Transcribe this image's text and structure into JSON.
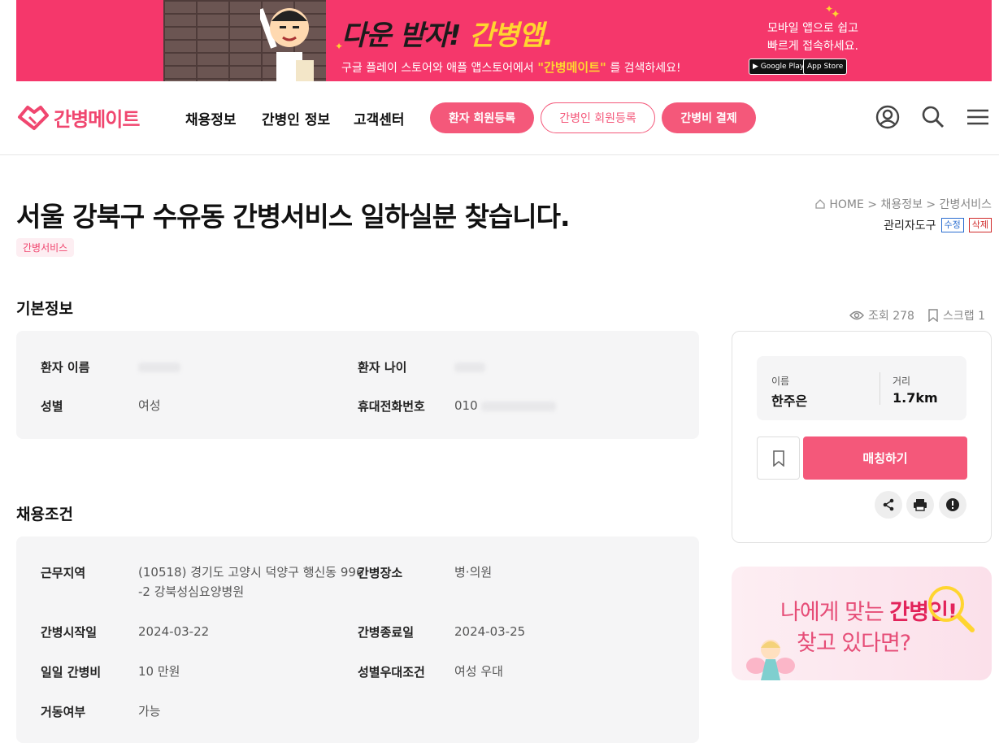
{
  "banner": {
    "title_a": "다운 받자!",
    "title_b": "간병앱.",
    "sub_a": "구글 플레이 스토어와 애플 앱스토어에서",
    "sub_q": "\"간병메이트\"",
    "sub_b": "를 검색하세요!",
    "right_l1": "모바일 앱으로 쉽고",
    "right_l2": "빠르게 접속하세요.",
    "google_play": "Google Play",
    "app_store": "App Store"
  },
  "nav": {
    "logo": "간병메이트",
    "menu": [
      "채용정보",
      "간병인 정보",
      "고객센터"
    ],
    "btn_patient": "환자 회원등록",
    "btn_caregiver": "간병인 회원등록",
    "btn_pay": "간병비 결제"
  },
  "post": {
    "title": "서울 강북구 수유동 간병서비스 일하실분 찾습니다.",
    "tag": "간병서비스",
    "breadcrumb": "HOME > 채용정보 > 간병서비스",
    "admin_label": "관리자도구",
    "edit": "수정",
    "delete": "삭제"
  },
  "basic": {
    "heading": "기본정보",
    "name_label": "환자 이름",
    "age_label": "환자 나이",
    "gender_label": "성별",
    "gender_value": "여성",
    "phone_label": "휴대전화번호",
    "phone_value": "010"
  },
  "conditions": {
    "heading": "채용조건",
    "area_label": "근무지역",
    "area_value_1": "(10518) 경기도 고양시 덕양구 행신동 996",
    "area_value_2": "-2 강북성심요양병원",
    "place_label": "간병장소",
    "place_value": "병·의원",
    "start_label": "간병시작일",
    "start_value": "2024-03-22",
    "end_label": "간병종료일",
    "end_value": "2024-03-25",
    "fee_label": "일일 간병비",
    "fee_value": "10 만원",
    "pref_label": "성별우대조건",
    "pref_value": "여성 우대",
    "mobility_label": "거동여부",
    "mobility_value": "가능"
  },
  "stats": {
    "views": "조회 278",
    "scraps": "스크랩 1"
  },
  "card": {
    "name_label": "이름",
    "name_value": "한주은",
    "dist_label": "거리",
    "dist_value": "1.7km",
    "match": "매칭하기"
  },
  "ad": {
    "line1_a": "나에게 맞는",
    "line1_b": "간병인!",
    "line2": "찾고 있다면?"
  },
  "colors": {
    "brand": "#f4587a",
    "banner": "#f5376b",
    "highlight": "#ffd530"
  }
}
